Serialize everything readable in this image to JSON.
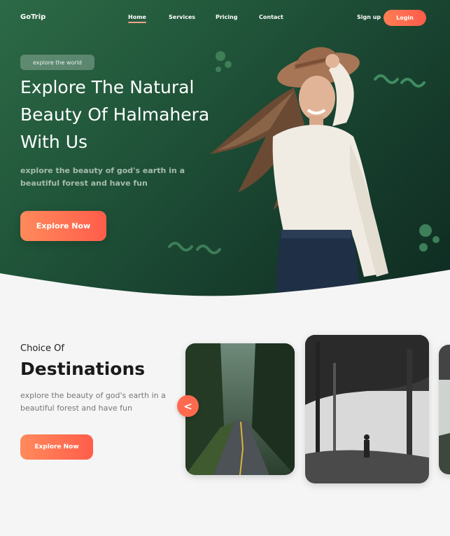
{
  "brand": "GoTrip",
  "nav": {
    "links": [
      "Home",
      "Services",
      "Pricing",
      "Contact"
    ],
    "active": "Home",
    "signup": "Sign up",
    "login": "Login"
  },
  "hero": {
    "badge": "explore the world",
    "title_lines": [
      "Explore The Natural",
      "Beauty Of Halmahera",
      "With Us"
    ],
    "subtitle": "explore the beauty of god's earth in a beautiful forest and have fun",
    "cta": "Explore Now"
  },
  "destinations": {
    "kicker": "Choice Of",
    "title": "Destinations",
    "subtitle": "explore the beauty of god's earth in a beautiful forest and have fun",
    "cta": "Explore Now",
    "prev_icon": "<",
    "cards": [
      "forest-road-photo",
      "misty-forest-hiker-photo",
      "forest-photo-partial"
    ]
  },
  "colors": {
    "accent": "#ff6a4f",
    "hero_green": "#1f5238",
    "background": "#f5f5f5"
  }
}
